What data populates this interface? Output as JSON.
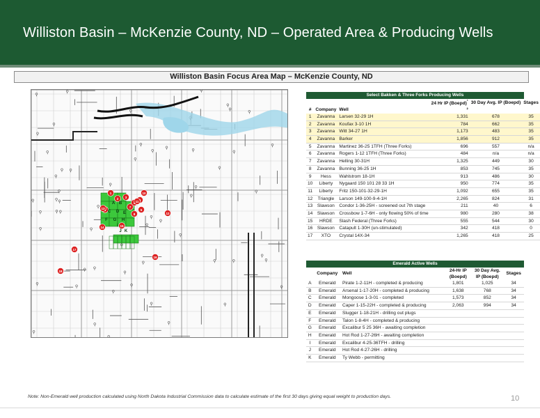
{
  "header": {
    "title": "Williston Basin – McKenzie County, ND – Operated Area & Producing Wells"
  },
  "map": {
    "title": "Williston Basin Focus Area Map – McKenzie County, ND",
    "well_markers": [
      "1",
      "2",
      "3",
      "4",
      "5",
      "6",
      "7",
      "8",
      "9",
      "10",
      "11",
      "12",
      "13",
      "14",
      "15",
      "16",
      "17",
      "18"
    ],
    "emerald_markers": [
      "A",
      "B",
      "C",
      "D",
      "E",
      "F",
      "G",
      "H",
      "I",
      "J",
      "K"
    ],
    "colors": {
      "emerald_acreage": "#3cc83c",
      "marker": "#dd2222",
      "river": "#7ec8e3",
      "roads": "#888888",
      "county_line": "#222222"
    }
  },
  "bakken_table": {
    "title": "Select Bakken & Three Forks Producing Wells",
    "headers": {
      "num": "#",
      "company": "Company",
      "well": "Well",
      "ip24": "24 Hr IP (Boepd)",
      "ip_note": "¹",
      "ip_extra": "²",
      "avg30": "30 Day Avg. IP (Boepd)",
      "stages": "Stages"
    },
    "rows": [
      {
        "num": "1",
        "company": "Zavanna",
        "well": "Larsen 32-29 1H",
        "ip": "1,331",
        "avg": "678",
        "stages": "35",
        "highlight": true
      },
      {
        "num": "2",
        "company": "Zavanna",
        "well": "Koufax 3-10 1H",
        "ip": "784",
        "avg": "662",
        "stages": "35",
        "highlight": true
      },
      {
        "num": "3",
        "company": "Zavanna",
        "well": "Witt 34-27 1H",
        "ip": "1,173",
        "avg": "483",
        "stages": "35",
        "highlight": true
      },
      {
        "num": "4",
        "company": "Zavanna",
        "well": "Barker",
        "ip": "1,856",
        "avg": "912",
        "stages": "35",
        "highlight": true
      },
      {
        "num": "5",
        "company": "Zavanna",
        "well": "Martinez 36-25 1TFH (Three Forks)",
        "ip": "696",
        "avg": "557",
        "stages": "n/a",
        "highlight": false
      },
      {
        "num": "6",
        "company": "Zavanna",
        "well": "Rogers 1-12 1TFH (Three Forks)",
        "ip": "484",
        "avg": "n/a",
        "stages": "n/a",
        "highlight": false
      },
      {
        "num": "7",
        "company": "Zavanna",
        "well": "Helling 30-31H",
        "ip": "1,325",
        "avg": "449",
        "stages": "30",
        "highlight": false
      },
      {
        "num": "8",
        "company": "Zavanna",
        "well": "Bunning 36-25 1H",
        "ip": "853",
        "avg": "745",
        "stages": "35",
        "highlight": false
      },
      {
        "num": "9",
        "company": "Hess",
        "well": "Wahlstrom 18-1H",
        "ip": "913",
        "avg": "486",
        "stages": "30",
        "highlight": false
      },
      {
        "num": "10",
        "company": "Liberty",
        "well": "Nygaard 150 101 28 33 1H",
        "ip": "950",
        "avg": "774",
        "stages": "35",
        "highlight": false
      },
      {
        "num": "11",
        "company": "Liberty",
        "well": "Fritz 150-101-32-29-1H",
        "ip": "1,092",
        "avg": "655",
        "stages": "35",
        "highlight": false
      },
      {
        "num": "12",
        "company": "Triangle",
        "well": "Larson 149-100-9-4-1H",
        "ip": "2,265",
        "avg": "824",
        "stages": "31",
        "highlight": false
      },
      {
        "num": "13",
        "company": "Slawson",
        "well": "Condor 1-36-25H - screened out 7th stage",
        "ip": "211",
        "avg": "40",
        "stages": "6",
        "highlight": false
      },
      {
        "num": "14",
        "company": "Slawson",
        "well": "Crossbow 1-7-6H - only flowing 50% of time",
        "ip": "980",
        "avg": "280",
        "stages": "38",
        "highlight": false
      },
      {
        "num": "15",
        "company": "HRDE",
        "well": "Slash Federal (Three Forks)",
        "ip": "555",
        "avg": "544",
        "stages": "30",
        "highlight": false
      },
      {
        "num": "16",
        "company": "Slawson",
        "well": "Catapult 1-30H (un-stimulated)",
        "ip": "342",
        "avg": "418",
        "stages": "0",
        "highlight": false
      },
      {
        "num": "17",
        "company": "XTO",
        "well": "Crystal 14X-34",
        "ip": "1,265",
        "avg": "418",
        "stages": "25",
        "highlight": false
      }
    ]
  },
  "emerald_table": {
    "title": "Emerald Active Wells",
    "headers": {
      "company": "Company",
      "well": "Well",
      "ip24": "24-Hr IP (Boepd)",
      "avg30": "30 Day Avg. IP (Boepd)",
      "stages": "Stages"
    },
    "rows": [
      {
        "id": "A",
        "company": "Emerald",
        "well": "Pirate 1-2-11H - completed & producing",
        "ip": "1,801",
        "avg": "1,025",
        "stages": "34"
      },
      {
        "id": "B",
        "company": "Emerald",
        "well": "Arsenal 1-17-20H - completed & producing",
        "ip": "1,638",
        "avg": "768",
        "stages": "34"
      },
      {
        "id": "C",
        "company": "Emerald",
        "well": "Mongoose 1-3-01 - completed",
        "ip": "1,573",
        "avg": "852",
        "stages": "34"
      },
      {
        "id": "D",
        "company": "Emerald",
        "well": "Caper 1-15-22H - completed & producing",
        "ip": "2,063",
        "avg": "994",
        "stages": "34"
      },
      {
        "id": "E",
        "company": "Emerald",
        "well": "Slugger 1-18-21H - drilling out plugs",
        "ip": "",
        "avg": "",
        "stages": ""
      },
      {
        "id": "F",
        "company": "Emerald",
        "well": "Talon 1-8-4H - completed & producing",
        "ip": "",
        "avg": "",
        "stages": ""
      },
      {
        "id": "G",
        "company": "Emerald",
        "well": "Excalibur 5 25 36H - awaiting completion",
        "ip": "",
        "avg": "",
        "stages": ""
      },
      {
        "id": "H",
        "company": "Emerald",
        "well": "Hot Rod 1-27-26H - awaiting completion",
        "ip": "",
        "avg": "",
        "stages": ""
      },
      {
        "id": "I",
        "company": "Emerald",
        "well": "Excalibur 4-25-36TFH - drilling",
        "ip": "",
        "avg": "",
        "stages": ""
      },
      {
        "id": "J",
        "company": "Emerald",
        "well": "Hot Rod 4-27-26H - drilling",
        "ip": "",
        "avg": "",
        "stages": ""
      },
      {
        "id": "K",
        "company": "Emerald",
        "well": "Ty Webb - permitting",
        "ip": "",
        "avg": "",
        "stages": ""
      }
    ]
  },
  "footer": {
    "note": "Note: Non-Emerald well production calculated using North Dakota Industrial Commission data to calculate estimate of the first 30 days giving equal weight to production days.",
    "page_number": "10"
  }
}
